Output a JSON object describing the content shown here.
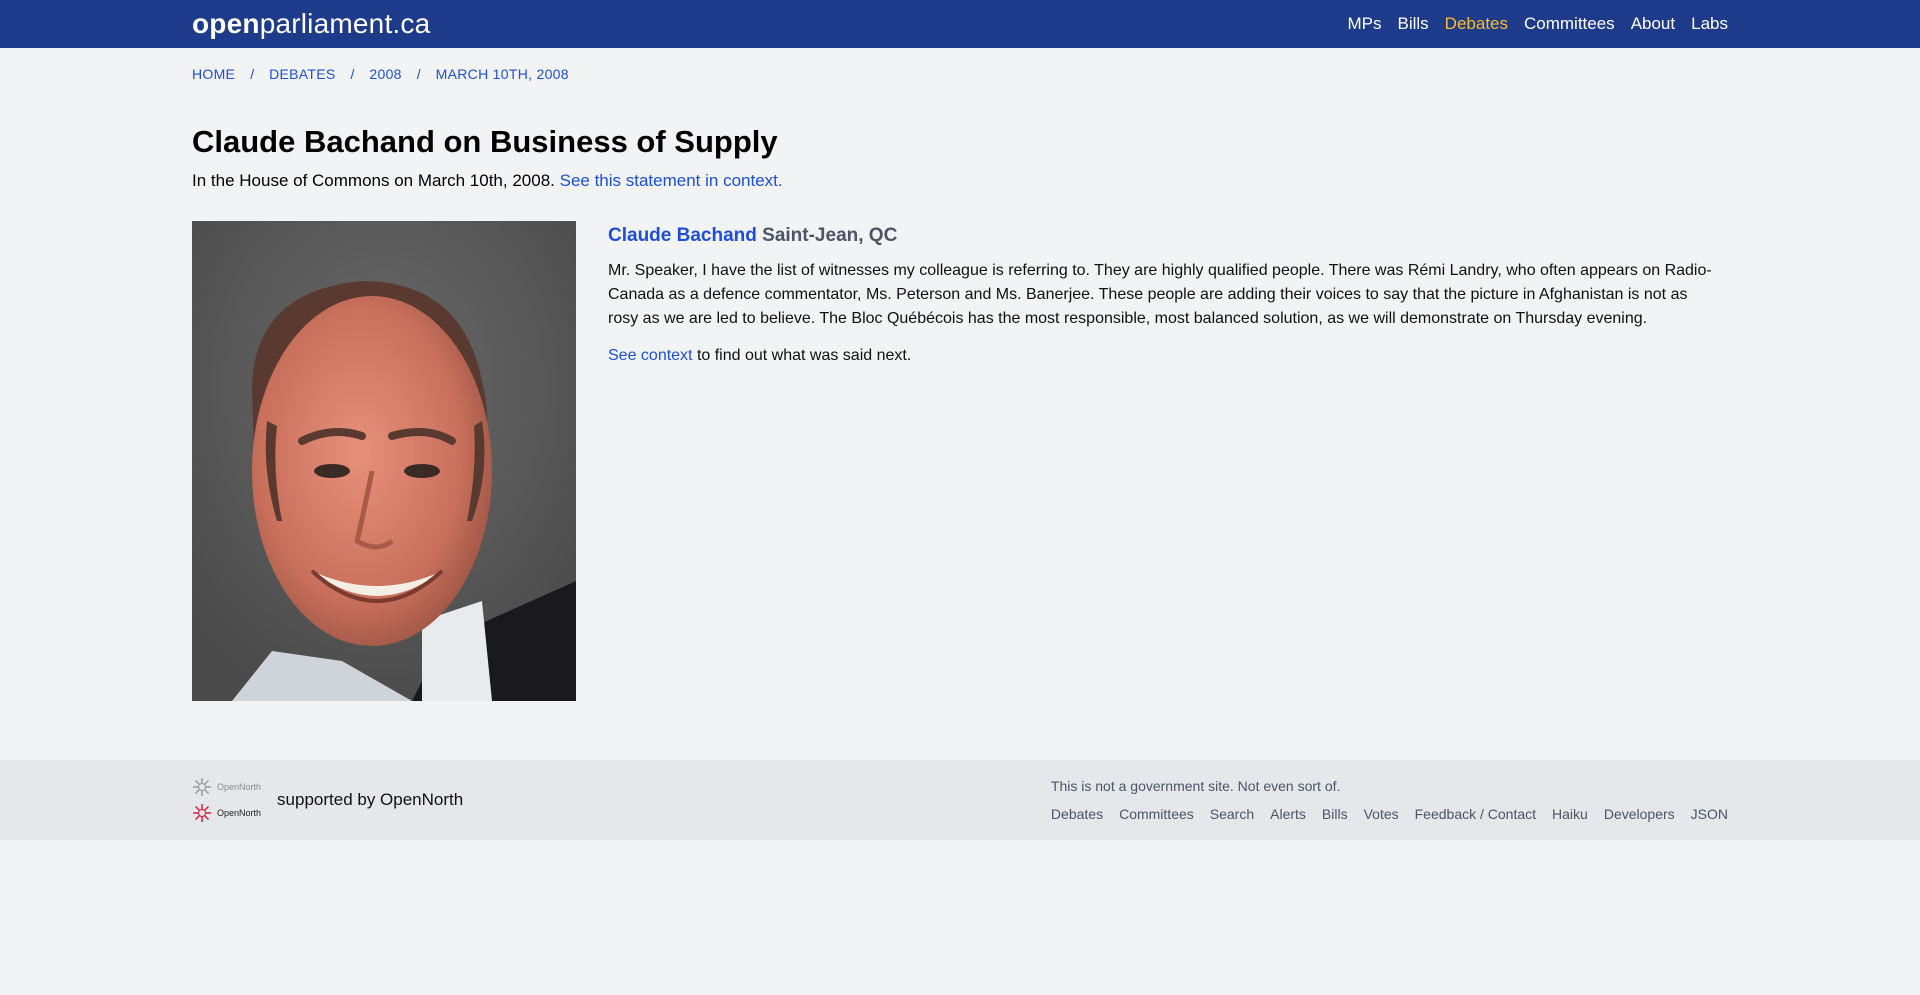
{
  "header": {
    "logo_bold": "open",
    "logo_rest": "parliament.ca",
    "nav": [
      {
        "label": "MPs"
      },
      {
        "label": "Bills"
      },
      {
        "label": "Debates",
        "active": true
      },
      {
        "label": "Committees"
      },
      {
        "label": "About"
      },
      {
        "label": "Labs"
      }
    ],
    "active_color": "#fbbf24",
    "bar_color": "#1e3a8a"
  },
  "breadcrumb": [
    {
      "label": "HOME"
    },
    {
      "label": "DEBATES"
    },
    {
      "label": "2008"
    },
    {
      "label": "MARCH 10TH, 2008"
    }
  ],
  "breadcrumb_separator": "/",
  "page": {
    "title": "Claude Bachand on Business of Supply",
    "subtitle_text": "In the House of Commons on March 10th, 2008.",
    "subtitle_link": "See this statement in context."
  },
  "statement": {
    "speaker_name": "Claude Bachand",
    "riding": "Saint-Jean, QC",
    "text": "Mr. Speaker, I have the list of witnesses my colleague is referring to. They are highly qualified people. There was Rémi Landry, who often appears on Radio-Canada as a defence commentator, Ms. Peterson and Ms. Banerjee. These people are adding their voices to say that the picture in Afghanistan is not as rosy as we are led to believe. The Bloc Québécois has the most responsible, most balanced solution, as we will demonstrate on Thursday evening.",
    "context_link": "See context",
    "context_rest": " to find out what was said next."
  },
  "footer": {
    "logo_text_1": "OpenNorth",
    "logo_text_2": "OpenNorth",
    "supported": "supported by OpenNorth",
    "disclaimer": "This is not a government site. Not even sort of.",
    "links": [
      {
        "label": "Debates"
      },
      {
        "label": "Committees"
      },
      {
        "label": "Search"
      },
      {
        "label": "Alerts"
      },
      {
        "label": "Bills"
      },
      {
        "label": "Votes"
      },
      {
        "label": "Feedback / Contact"
      },
      {
        "label": "Haiku"
      },
      {
        "label": "Developers"
      },
      {
        "label": "JSON"
      }
    ]
  }
}
